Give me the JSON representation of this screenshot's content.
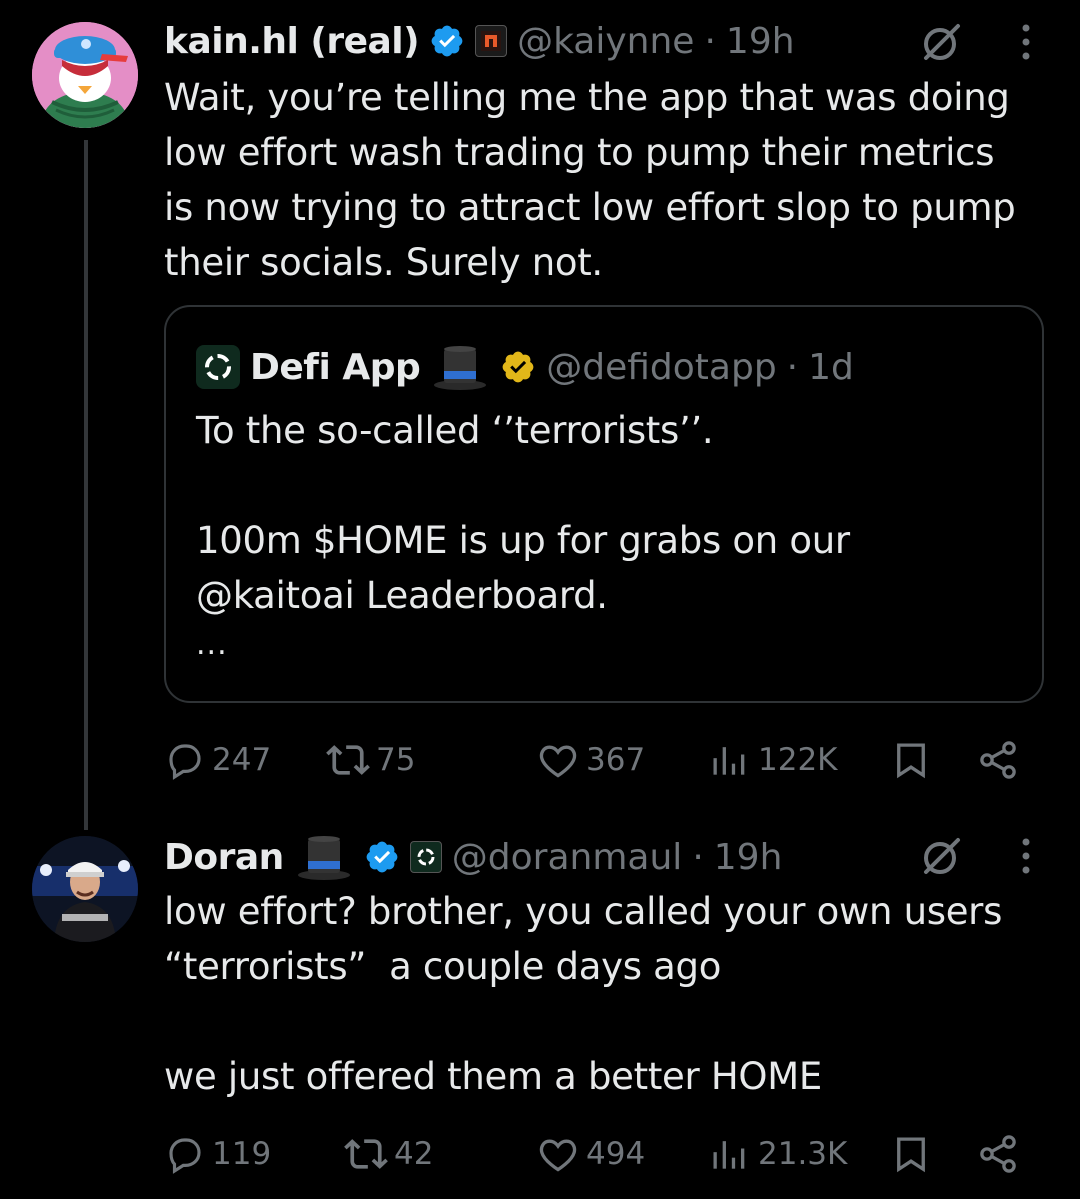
{
  "tweets": [
    {
      "name": "kain.hl (real)",
      "handle": "@kaiynne",
      "time": "19h",
      "text": "Wait, you’re telling me the app that was doing\nlow effort wash trading to pump their metrics\nis now trying to attract low effort slop to pump\ntheir socials. Surely not.",
      "quote": {
        "name": "Defi App",
        "handle": "@defidotapp",
        "time": "1d",
        "text": "To the so-called ‘’terrorists’’.\n\n100m $HOME is up for grabs on our\n@kaitoai Leaderboard.",
        "ellipsis": "..."
      },
      "stats": {
        "replies": "247",
        "reposts": "75",
        "likes": "367",
        "views": "122K"
      }
    },
    {
      "name": "Doran",
      "handle": "@doranmaul",
      "time": "19h",
      "text": "low effort? brother, you called your own users\n“terrorists”  a couple days ago\n\nwe just offered them a better HOME",
      "stats": {
        "replies": "119",
        "reposts": "42",
        "likes": "494",
        "views": "21.3K"
      }
    }
  ],
  "separator": "·",
  "colors": {
    "background": "#000000",
    "text": "#e7e9ea",
    "muted": "#71767b",
    "verified_blue": "#1d9bf0",
    "verified_gold": "#e2b719",
    "border": "#2f3336"
  },
  "icons": [
    "verified-blue-icon",
    "verified-gold-icon",
    "top-hat-icon",
    "grok-icon",
    "more-icon",
    "reply-icon",
    "repost-icon",
    "like-icon",
    "views-icon",
    "bookmark-icon",
    "share-icon"
  ]
}
